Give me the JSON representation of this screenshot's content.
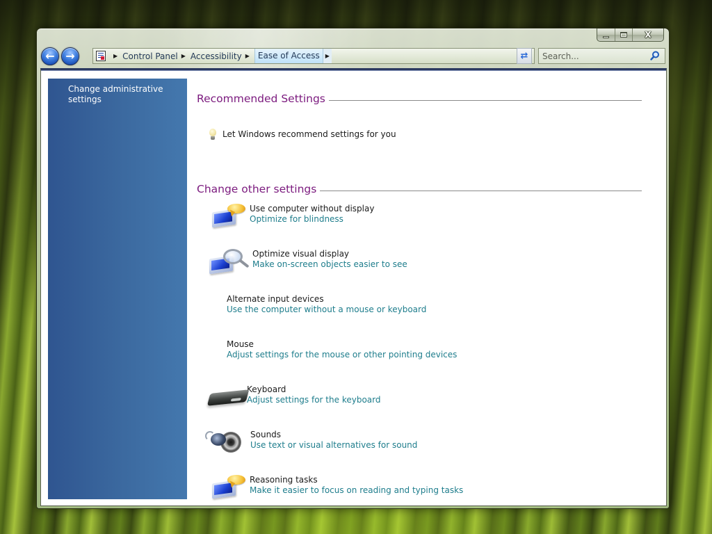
{
  "window": {
    "caption_buttons": {
      "minimize_icon": "minimize-icon",
      "maximize_icon": "maximize-icon",
      "close_glyph": "X"
    }
  },
  "navigation": {
    "back_glyph": "←",
    "forward_glyph": "→",
    "address_icon": "control-panel-icon",
    "breadcrumbs": [
      {
        "label": "Control Panel"
      },
      {
        "label": "Accessibility"
      },
      {
        "label": "Ease of Access"
      }
    ],
    "separator_glyph": "▶",
    "dropdown_glyph": "▼",
    "refresh_glyph": "⇄",
    "search": {
      "placeholder": "Search...",
      "value": ""
    }
  },
  "sidebar": {
    "links": [
      {
        "label": "Change administrative settings"
      }
    ],
    "color": "#3a659c"
  },
  "main": {
    "recommended": {
      "title": "Recommended Settings",
      "items": [
        {
          "label": "Let Windows recommend settings for you",
          "icon": "lightbulb-icon"
        }
      ]
    },
    "other": {
      "title": "Change other settings",
      "tasks": [
        {
          "title": "Use computer without display",
          "link": "Optimize for blindness",
          "icon": "monitor-speech-icon"
        },
        {
          "title": "Optimize visual display",
          "link": "Make on-screen objects easier to see",
          "icon": "monitor-magnifier-icon"
        },
        {
          "title": "Alternate input devices",
          "link": "Use the computer without a mouse or keyboard",
          "icon": ""
        },
        {
          "title": "Mouse",
          "link": "Adjust settings for the mouse or other pointing devices",
          "icon": ""
        },
        {
          "title": "Keyboard",
          "link": "Adjust settings for the keyboard",
          "icon": "keyboard-icon"
        },
        {
          "title": "Sounds",
          "link": "Use text or visual alternatives for sound",
          "icon": "speakers-icon"
        },
        {
          "title": "Reasoning tasks",
          "link": "Make it easier to focus on reading and typing tasks",
          "icon": "monitor-speech-icon"
        }
      ]
    }
  },
  "colors": {
    "section_title": "#7b1a7e",
    "link": "#1e7d8c",
    "sidebar": "#3a659c"
  }
}
